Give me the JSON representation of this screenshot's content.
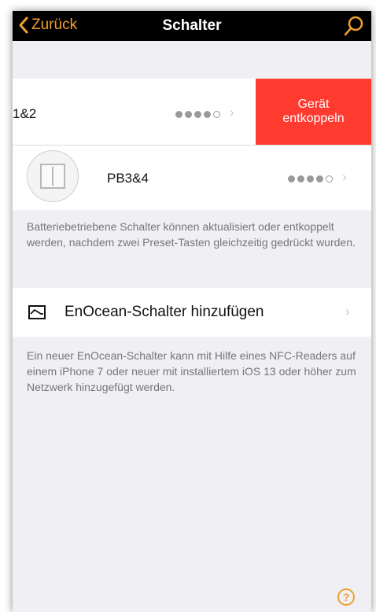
{
  "nav": {
    "back_label": "Zurück",
    "title": "Schalter",
    "search_icon": "search-icon",
    "accent_color": "#f0a030"
  },
  "switches": [
    {
      "name": "1&2",
      "signal_level": 4,
      "signal_max": 5,
      "swipe_action_label_line1": "Gerät",
      "swipe_action_label_line2": "entkoppeln",
      "swipe_action_color": "#ff3b30"
    },
    {
      "name": "PB3&4",
      "signal_level": 4,
      "signal_max": 5,
      "icon": "wall-switch-image"
    }
  ],
  "battery_note": "Batteriebetriebene Schalter können aktualisiert oder entkoppelt werden, nachdem zwei Preset-Tasten gleichzeitig gedrückt wurden.",
  "add_switch": {
    "label": "EnOcean-Schalter hinzufügen",
    "icon": "enocean-switch-icon"
  },
  "add_note": "Ein neuer EnOcean-Schalter kann mit Hilfe eines NFC-Readers auf einem iPhone 7 oder neuer mit installiertem iOS 13 oder höher zum Netzwerk hinzugefügt werden.",
  "help": {
    "label": "?"
  }
}
